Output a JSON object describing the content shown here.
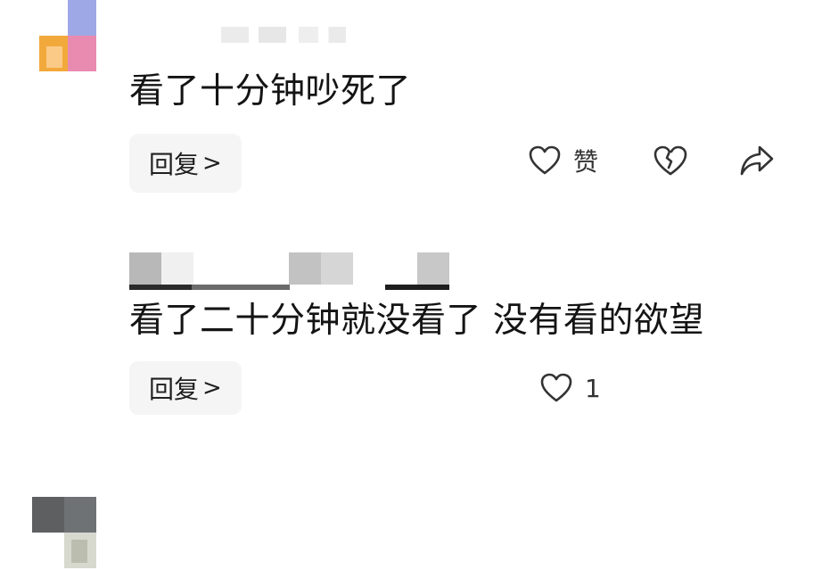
{
  "comments": [
    {
      "text": "看了十分钟吵死了",
      "reply_label": "回复",
      "reply_chevron": ">",
      "like_label": "赞",
      "icons": [
        "heart-icon",
        "broken-heart-icon",
        "share-icon"
      ]
    },
    {
      "text": "看了二十分钟就没看了 没有看的欲望",
      "reply_label": "回复",
      "reply_chevron": ">",
      "like_label": "1",
      "icons": [
        "heart-icon"
      ]
    }
  ],
  "colors": {
    "avatar1": [
      "#9fa8e6",
      "#f2a93b",
      "#e98bb0"
    ],
    "avatar2": [
      "#5d5f61",
      "#8a8d8f",
      "#d7d9cf"
    ],
    "button_bg": "#f5f5f5",
    "text": "#141414"
  }
}
